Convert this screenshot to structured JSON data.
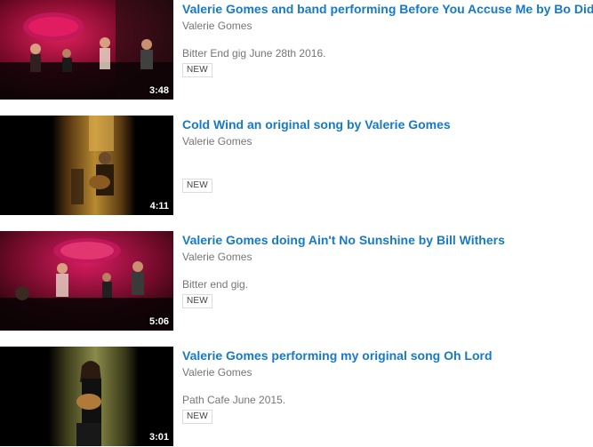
{
  "videos": [
    {
      "title": "Valerie Gomes and band performing Before You Accuse Me by Bo Diddly",
      "channel": "Valerie Gomes",
      "description": "Bitter End gig June 28th 2016.",
      "duration": "3:48",
      "badge": "NEW"
    },
    {
      "title": "Cold Wind an original song by Valerie Gomes",
      "channel": "Valerie Gomes",
      "description": "",
      "duration": "4:11",
      "badge": "NEW"
    },
    {
      "title": "Valerie Gomes doing Ain't No Sunshine by Bill Withers",
      "channel": "Valerie Gomes",
      "description": "Bitter end gig.",
      "duration": "5:06",
      "badge": "NEW"
    },
    {
      "title": "Valerie Gomes performing my original song Oh Lord",
      "channel": "Valerie Gomes",
      "description": "Path Cafe June 2015.",
      "duration": "3:01",
      "badge": "NEW"
    }
  ]
}
